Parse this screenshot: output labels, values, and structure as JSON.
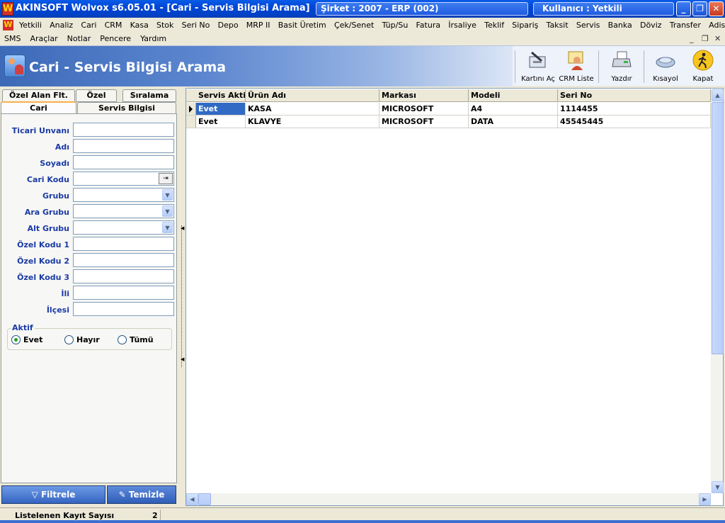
{
  "window": {
    "title": "AKINSOFT Wolvox s6.05.01 - [Cari - Servis Bilgisi Arama]",
    "company": "Şirket : 2007 - ERP (002)",
    "user": "Kullanıcı : Yetkili",
    "min_glyph": "_",
    "max_glyph": "❐",
    "close_glyph": "✕",
    "logo_letter": "W"
  },
  "menu": {
    "row1": [
      "Yetkili",
      "Analiz",
      "Cari",
      "CRM",
      "Kasa",
      "Stok",
      "Seri No",
      "Depo",
      "MRP II",
      "Basit Üretim",
      "Çek/Senet",
      "Tüp/Su",
      "Fatura",
      "İrsaliye",
      "Teklif",
      "Sipariş",
      "Taksit",
      "Servis",
      "Banka",
      "Döviz",
      "Transfer",
      "Adisyon"
    ],
    "row2": [
      "SMS",
      "Araçlar",
      "Notlar",
      "Pencere",
      "Yardım"
    ],
    "mdi_min": "_",
    "mdi_restore": "❐",
    "mdi_close": "✕"
  },
  "header": {
    "title": "Cari - Servis Bilgisi Arama",
    "tools": [
      {
        "label": "Kartını Aç",
        "icon": "card-open-icon"
      },
      {
        "label": "CRM Liste",
        "icon": "crm-list-icon"
      },
      {
        "label": "Yazdır",
        "icon": "printer-icon"
      },
      {
        "label": "Kısayol",
        "icon": "shortcut-icon"
      },
      {
        "label": "Kapat",
        "icon": "exit-icon"
      }
    ]
  },
  "tabs": {
    "top": [
      "Özel Alan Flt.",
      "Özel",
      "Sıralama"
    ],
    "bottom": [
      "Cari",
      "Servis Bilgisi"
    ]
  },
  "form": {
    "ticari_unvani": {
      "label": "Ticari Unvanı",
      "value": ""
    },
    "adi": {
      "label": "Adı",
      "value": ""
    },
    "soyadi": {
      "label": "Soyadı",
      "value": ""
    },
    "cari_kodu": {
      "label": "Cari Kodu",
      "value": ""
    },
    "grubu": {
      "label": "Grubu",
      "value": ""
    },
    "ara_grubu": {
      "label": "Ara Grubu",
      "value": ""
    },
    "alt_grubu": {
      "label": "Alt Grubu",
      "value": ""
    },
    "ozel_kodu_1": {
      "label": "Özel Kodu 1",
      "value": ""
    },
    "ozel_kodu_2": {
      "label": "Özel Kodu 2",
      "value": ""
    },
    "ozel_kodu_3": {
      "label": "Özel Kodu 3",
      "value": ""
    },
    "ili": {
      "label": "İli",
      "value": ""
    },
    "ilcesi": {
      "label": "İlçesi",
      "value": ""
    }
  },
  "aktif": {
    "title": "Aktif",
    "options": [
      "Evet",
      "Hayır",
      "Tümü"
    ],
    "selected": "Evet"
  },
  "buttons": {
    "filter": "Filtrele",
    "clear": "Temizle"
  },
  "grid": {
    "columns": [
      "Servis Aktif",
      "Ürün Adı",
      "Markası",
      "Modeli",
      "Seri No"
    ],
    "rows": [
      [
        "Evet",
        "KASA",
        "MICROSOFT",
        "A4",
        "1114455"
      ],
      [
        "Evet",
        "KLAVYE",
        "MICROSOFT",
        "DATA",
        "45545445"
      ]
    ]
  },
  "status": {
    "label": "Listelenen Kayıt Sayısı",
    "count": "2"
  }
}
